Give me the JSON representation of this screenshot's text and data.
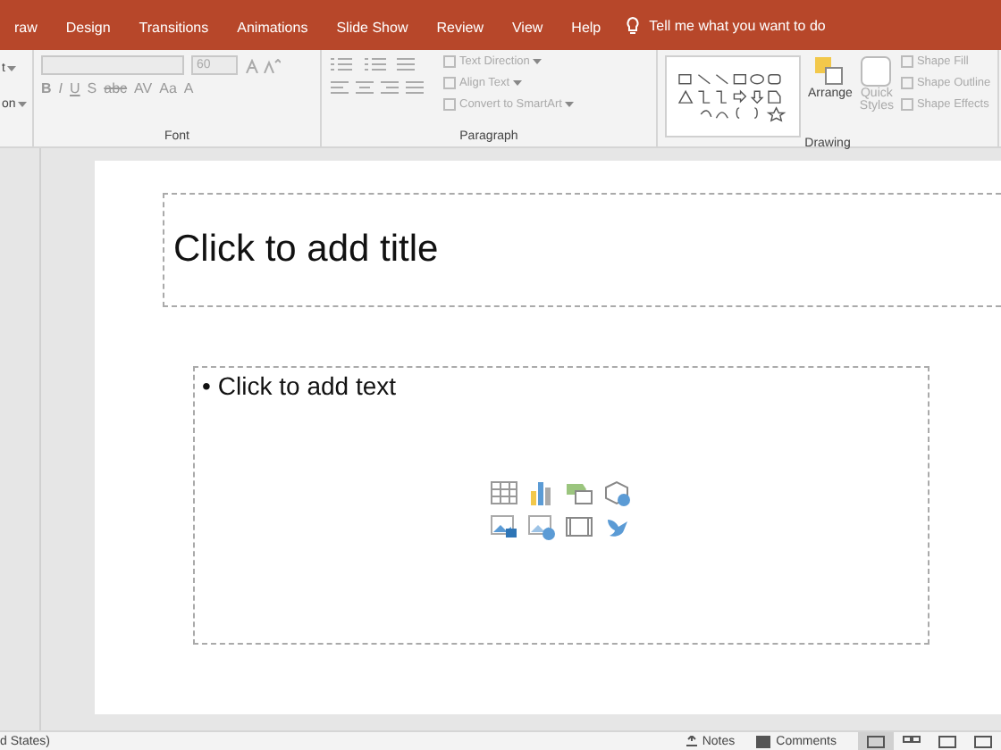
{
  "tabs": [
    {
      "label": "raw",
      "selected": false
    },
    {
      "label": "Design",
      "selected": false
    },
    {
      "label": "Transitions",
      "selected": false
    },
    {
      "label": "Animations",
      "selected": false
    },
    {
      "label": "Slide Show",
      "selected": false
    },
    {
      "label": "Review",
      "selected": false
    },
    {
      "label": "View",
      "selected": false
    },
    {
      "label": "Help",
      "selected": false
    }
  ],
  "tell_me": "Tell me what you want to do",
  "slides_group": {
    "items": [
      "t",
      "on"
    ]
  },
  "font_group": {
    "label": "Font",
    "font_size": "60",
    "format_buttons": [
      "B",
      "I",
      "U",
      "S",
      "abc",
      "AV",
      "Aa"
    ],
    "font_color": "A"
  },
  "paragraph_group": {
    "label": "Paragraph",
    "commands": [
      "Text Direction",
      "Align Text",
      "Convert to SmartArt"
    ]
  },
  "drawing_group": {
    "label": "Drawing",
    "arrange": "Arrange",
    "quick_styles": [
      "Quick",
      "Styles"
    ],
    "commands": [
      "Shape Fill",
      "Shape Outline",
      "Shape Effects"
    ]
  },
  "slide": {
    "title_placeholder": "Click to add title",
    "bullet": "•",
    "content_placeholder": "Click to add text"
  },
  "status_bar": {
    "language": "d States)",
    "notes": "Notes",
    "comments": "Comments"
  }
}
